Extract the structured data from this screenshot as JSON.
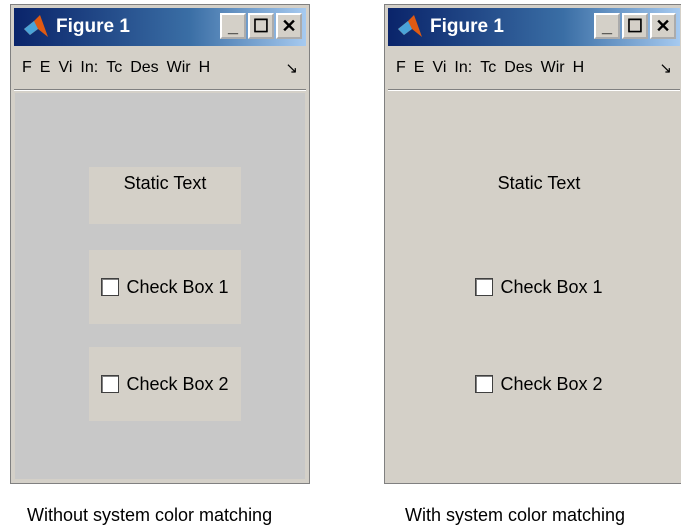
{
  "figures": [
    {
      "title": "Figure 1",
      "menu": [
        "F",
        "E",
        "Vi",
        "In:",
        "Tc",
        "Des",
        "Wir",
        "H",
        "↘"
      ],
      "bg_color": "#c8c8c8",
      "control_bg": "#d4d0c8",
      "static_text": "Static Text",
      "checkbox1": "Check Box 1",
      "checkbox2": "Check Box 2",
      "caption": "Without system color matching"
    },
    {
      "title": "Figure 1",
      "menu": [
        "F",
        "E",
        "Vi",
        "In:",
        "Tc",
        "Des",
        "Wir",
        "H",
        "↘"
      ],
      "bg_color": "#d4d0c8",
      "control_bg": "#d4d0c8",
      "static_text": "Static Text",
      "checkbox1": "Check Box 1",
      "checkbox2": "Check Box 2",
      "caption": "With system color matching"
    }
  ],
  "window_buttons": [
    "_",
    "☐",
    "✕"
  ],
  "icon": "matlab-logo-icon"
}
